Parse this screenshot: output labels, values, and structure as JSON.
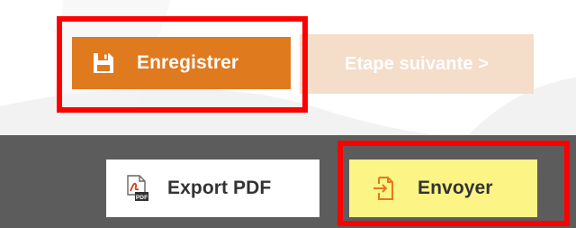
{
  "actions": {
    "save_label": "Enregistrer",
    "next_label": "Etape suivante >"
  },
  "toolbar": {
    "export_pdf_label": "Export PDF",
    "send_label": "Envoyer"
  },
  "icons": {
    "save": "floppy-disk-icon",
    "pdf": "pdf-file-icon",
    "send": "send-document-icon"
  },
  "colors": {
    "accent": "#e07a1f",
    "accent_disabled": "#f4ddc9",
    "toolbar_bg": "#5c5c5c",
    "send_bg": "#fcf484",
    "highlight": "#ff0000"
  }
}
